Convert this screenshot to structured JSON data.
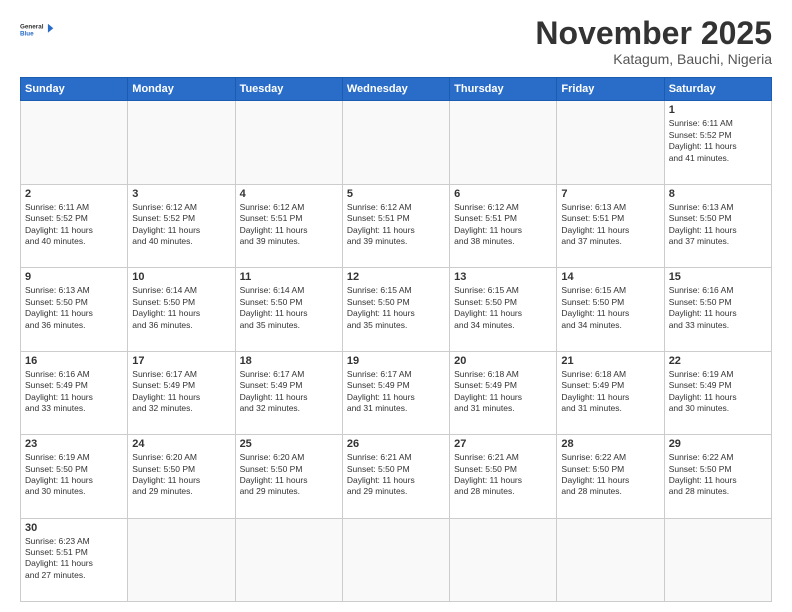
{
  "logo": {
    "general": "General",
    "blue": "Blue"
  },
  "header": {
    "month": "November 2025",
    "location": "Katagum, Bauchi, Nigeria"
  },
  "weekdays": [
    "Sunday",
    "Monday",
    "Tuesday",
    "Wednesday",
    "Thursday",
    "Friday",
    "Saturday"
  ],
  "weeks": [
    [
      {
        "day": "",
        "info": ""
      },
      {
        "day": "",
        "info": ""
      },
      {
        "day": "",
        "info": ""
      },
      {
        "day": "",
        "info": ""
      },
      {
        "day": "",
        "info": ""
      },
      {
        "day": "",
        "info": ""
      },
      {
        "day": "1",
        "info": "Sunrise: 6:11 AM\nSunset: 5:52 PM\nDaylight: 11 hours\nand 41 minutes."
      }
    ],
    [
      {
        "day": "2",
        "info": "Sunrise: 6:11 AM\nSunset: 5:52 PM\nDaylight: 11 hours\nand 40 minutes."
      },
      {
        "day": "3",
        "info": "Sunrise: 6:12 AM\nSunset: 5:52 PM\nDaylight: 11 hours\nand 40 minutes."
      },
      {
        "day": "4",
        "info": "Sunrise: 6:12 AM\nSunset: 5:51 PM\nDaylight: 11 hours\nand 39 minutes."
      },
      {
        "day": "5",
        "info": "Sunrise: 6:12 AM\nSunset: 5:51 PM\nDaylight: 11 hours\nand 39 minutes."
      },
      {
        "day": "6",
        "info": "Sunrise: 6:12 AM\nSunset: 5:51 PM\nDaylight: 11 hours\nand 38 minutes."
      },
      {
        "day": "7",
        "info": "Sunrise: 6:13 AM\nSunset: 5:51 PM\nDaylight: 11 hours\nand 37 minutes."
      },
      {
        "day": "8",
        "info": "Sunrise: 6:13 AM\nSunset: 5:50 PM\nDaylight: 11 hours\nand 37 minutes."
      }
    ],
    [
      {
        "day": "9",
        "info": "Sunrise: 6:13 AM\nSunset: 5:50 PM\nDaylight: 11 hours\nand 36 minutes."
      },
      {
        "day": "10",
        "info": "Sunrise: 6:14 AM\nSunset: 5:50 PM\nDaylight: 11 hours\nand 36 minutes."
      },
      {
        "day": "11",
        "info": "Sunrise: 6:14 AM\nSunset: 5:50 PM\nDaylight: 11 hours\nand 35 minutes."
      },
      {
        "day": "12",
        "info": "Sunrise: 6:15 AM\nSunset: 5:50 PM\nDaylight: 11 hours\nand 35 minutes."
      },
      {
        "day": "13",
        "info": "Sunrise: 6:15 AM\nSunset: 5:50 PM\nDaylight: 11 hours\nand 34 minutes."
      },
      {
        "day": "14",
        "info": "Sunrise: 6:15 AM\nSunset: 5:50 PM\nDaylight: 11 hours\nand 34 minutes."
      },
      {
        "day": "15",
        "info": "Sunrise: 6:16 AM\nSunset: 5:50 PM\nDaylight: 11 hours\nand 33 minutes."
      }
    ],
    [
      {
        "day": "16",
        "info": "Sunrise: 6:16 AM\nSunset: 5:49 PM\nDaylight: 11 hours\nand 33 minutes."
      },
      {
        "day": "17",
        "info": "Sunrise: 6:17 AM\nSunset: 5:49 PM\nDaylight: 11 hours\nand 32 minutes."
      },
      {
        "day": "18",
        "info": "Sunrise: 6:17 AM\nSunset: 5:49 PM\nDaylight: 11 hours\nand 32 minutes."
      },
      {
        "day": "19",
        "info": "Sunrise: 6:17 AM\nSunset: 5:49 PM\nDaylight: 11 hours\nand 31 minutes."
      },
      {
        "day": "20",
        "info": "Sunrise: 6:18 AM\nSunset: 5:49 PM\nDaylight: 11 hours\nand 31 minutes."
      },
      {
        "day": "21",
        "info": "Sunrise: 6:18 AM\nSunset: 5:49 PM\nDaylight: 11 hours\nand 31 minutes."
      },
      {
        "day": "22",
        "info": "Sunrise: 6:19 AM\nSunset: 5:49 PM\nDaylight: 11 hours\nand 30 minutes."
      }
    ],
    [
      {
        "day": "23",
        "info": "Sunrise: 6:19 AM\nSunset: 5:50 PM\nDaylight: 11 hours\nand 30 minutes."
      },
      {
        "day": "24",
        "info": "Sunrise: 6:20 AM\nSunset: 5:50 PM\nDaylight: 11 hours\nand 29 minutes."
      },
      {
        "day": "25",
        "info": "Sunrise: 6:20 AM\nSunset: 5:50 PM\nDaylight: 11 hours\nand 29 minutes."
      },
      {
        "day": "26",
        "info": "Sunrise: 6:21 AM\nSunset: 5:50 PM\nDaylight: 11 hours\nand 29 minutes."
      },
      {
        "day": "27",
        "info": "Sunrise: 6:21 AM\nSunset: 5:50 PM\nDaylight: 11 hours\nand 28 minutes."
      },
      {
        "day": "28",
        "info": "Sunrise: 6:22 AM\nSunset: 5:50 PM\nDaylight: 11 hours\nand 28 minutes."
      },
      {
        "day": "29",
        "info": "Sunrise: 6:22 AM\nSunset: 5:50 PM\nDaylight: 11 hours\nand 28 minutes."
      }
    ],
    [
      {
        "day": "30",
        "info": "Sunrise: 6:23 AM\nSunset: 5:51 PM\nDaylight: 11 hours\nand 27 minutes."
      },
      {
        "day": "",
        "info": ""
      },
      {
        "day": "",
        "info": ""
      },
      {
        "day": "",
        "info": ""
      },
      {
        "day": "",
        "info": ""
      },
      {
        "day": "",
        "info": ""
      },
      {
        "day": "",
        "info": ""
      }
    ]
  ]
}
